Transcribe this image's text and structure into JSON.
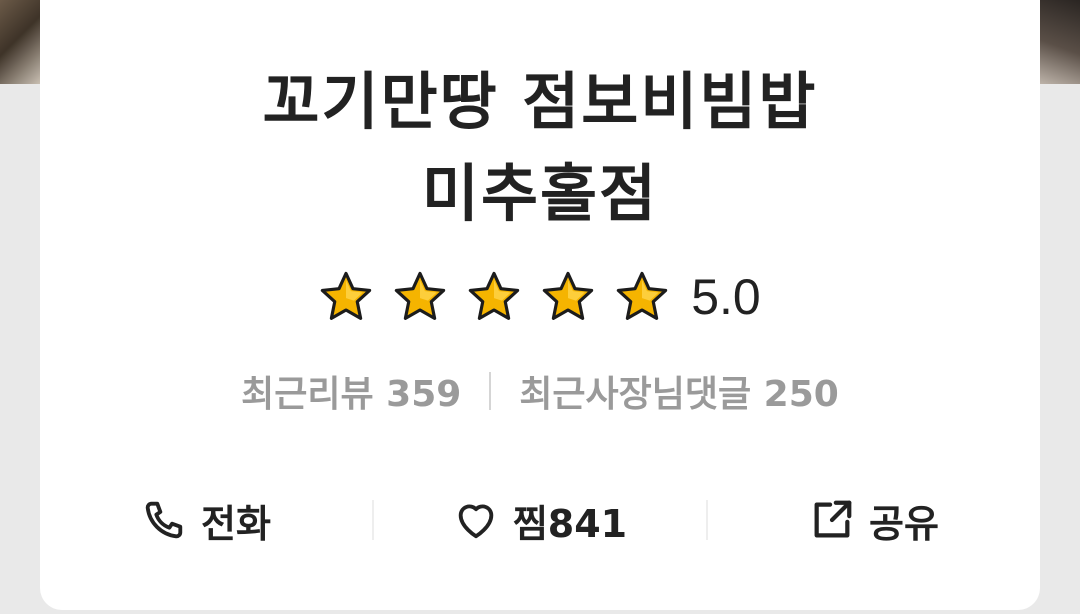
{
  "store": {
    "name_line1": "꼬기만땅 점보비빔밥",
    "name_line2": "미추홀점"
  },
  "rating": {
    "score": "5.0",
    "stars": 5,
    "star_color": "#f5b400"
  },
  "counts": {
    "reviews": "최근리뷰 359",
    "owner_replies": "최근사장님댓글 250"
  },
  "actions": {
    "call_label": "전화",
    "favorite_label": "찜841",
    "share_label": "공유"
  },
  "icons": {
    "call": "phone-icon",
    "favorite": "heart-icon",
    "share": "share-icon"
  }
}
